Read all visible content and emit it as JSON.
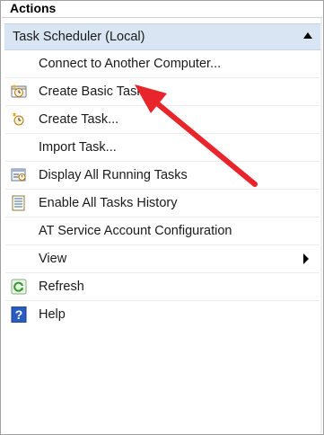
{
  "panel": {
    "title": "Actions"
  },
  "section": {
    "title": "Task Scheduler (Local)",
    "collapse_icon": "triangle-up-icon"
  },
  "items": [
    {
      "label": "Connect to Another Computer...",
      "icon": ""
    },
    {
      "label": "Create Basic Task...",
      "icon": "create-basic-task-icon"
    },
    {
      "label": "Create Task...",
      "icon": "create-task-icon"
    },
    {
      "label": "Import Task...",
      "icon": ""
    },
    {
      "label": "Display All Running Tasks",
      "icon": "running-tasks-icon"
    },
    {
      "label": "Enable All Tasks History",
      "icon": "tasks-history-icon"
    },
    {
      "label": "AT Service Account Configuration",
      "icon": ""
    },
    {
      "label": "View",
      "icon": "",
      "submenu": true
    },
    {
      "label": "Refresh",
      "icon": "refresh-icon"
    },
    {
      "label": "Help",
      "icon": "help-icon"
    }
  ],
  "colors": {
    "section_bg": "#d9e5f3",
    "arrow": "#e8252a"
  }
}
